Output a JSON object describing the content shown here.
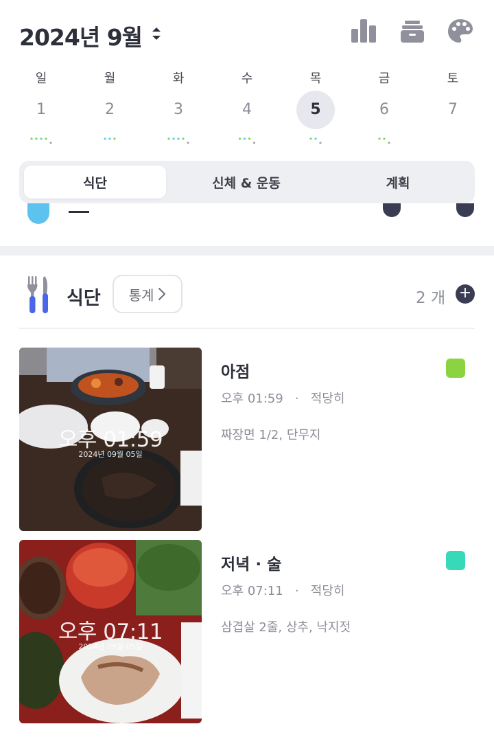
{
  "header": {
    "month_title": "2024년 9월",
    "icons": [
      "bar-chart-icon",
      "archive-box-icon",
      "palette-icon"
    ]
  },
  "week": {
    "days": [
      {
        "dow": "일",
        "num": "1",
        "dots": [
          "#7ed957",
          "#7ed957",
          "#5bd3e8",
          "#7ed957",
          "#aaaaaa"
        ]
      },
      {
        "dow": "월",
        "num": "2",
        "dots": [
          "#5bd3e8",
          "#5bd3e8",
          "#7ed957"
        ]
      },
      {
        "dow": "화",
        "num": "3",
        "dots": [
          "#7ed957",
          "#5bd3e8",
          "#5bd3e8",
          "#7ed957",
          "#aaaaaa"
        ]
      },
      {
        "dow": "수",
        "num": "4",
        "dots": [
          "#7ed957",
          "#5bd3e8",
          "#7ed957",
          "#aaaaaa"
        ]
      },
      {
        "dow": "목",
        "num": "5",
        "dots": [
          "#7ed957",
          "#5bd3e8",
          "#aaaaaa"
        ],
        "selected": true
      },
      {
        "dow": "금",
        "num": "6",
        "dots": [
          "#7ed957",
          "#7ed957",
          "#aaaaaa"
        ]
      },
      {
        "dow": "토",
        "num": "7",
        "dots": []
      }
    ]
  },
  "tabs": [
    "식단",
    "신체 & 운동",
    "계획"
  ],
  "active_tab": 0,
  "diet": {
    "title": "식단",
    "stats_label": "통계",
    "count_label": "2 개",
    "meals": [
      {
        "name": "아점",
        "time": "오후 01:59",
        "portion": "적당히",
        "desc": "짜장면 1/2, 단무지",
        "tag_color": "#8cd43f",
        "stamp_time": "오후 01:59",
        "stamp_date": "2024년 09월 05일"
      },
      {
        "name": "저녁 · 술",
        "time": "오후 07:11",
        "portion": "적당히",
        "desc": "삼겹살 2줄, 상추, 낙지젓",
        "tag_color": "#36d9b8",
        "stamp_time": "오후 07:11",
        "stamp_date": "2024년 09월 05일"
      }
    ]
  },
  "colors": {
    "accent": "#3a3c54",
    "selected_day_bg": "#e7e8ee",
    "tab_bg": "#eeeff3",
    "fork_blue": "#4a67e8"
  }
}
